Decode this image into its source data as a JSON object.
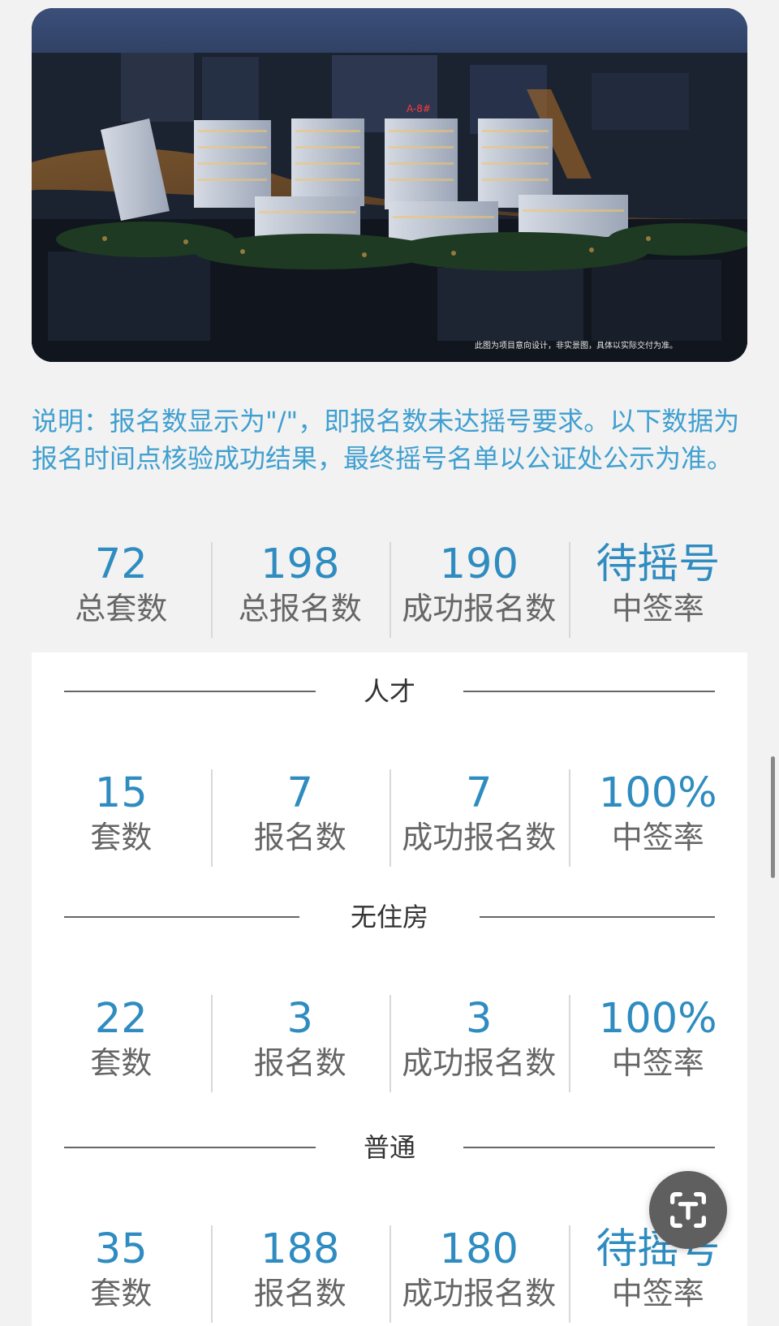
{
  "hero": {
    "caption": "此图为项目意向设计，非实景图，具体以实际交付为准。"
  },
  "notice": {
    "text": "说明：报名数显示为\"/\"，即报名数未达摇号要求。以下数据为报名时间点核验成功结果，最终摇号名单以公证处公示为准。"
  },
  "summary": {
    "items": [
      {
        "value": "72",
        "label": "总套数"
      },
      {
        "value": "198",
        "label": "总报名数"
      },
      {
        "value": "190",
        "label": "成功报名数"
      },
      {
        "value": "待摇号",
        "label": "中签率"
      }
    ]
  },
  "sections": [
    {
      "title": "人才",
      "items": [
        {
          "value": "15",
          "label": "套数"
        },
        {
          "value": "7",
          "label": "报名数"
        },
        {
          "value": "7",
          "label": "成功报名数"
        },
        {
          "value": "100%",
          "label": "中签率"
        }
      ]
    },
    {
      "title": "无住房",
      "items": [
        {
          "value": "22",
          "label": "套数"
        },
        {
          "value": "3",
          "label": "报名数"
        },
        {
          "value": "3",
          "label": "成功报名数"
        },
        {
          "value": "100%",
          "label": "中签率"
        }
      ]
    },
    {
      "title": "普通",
      "items": [
        {
          "value": "35",
          "label": "套数"
        },
        {
          "value": "188",
          "label": "报名数"
        },
        {
          "value": "180",
          "label": "成功报名数"
        },
        {
          "value": "待摇号",
          "label": "中签率"
        }
      ]
    }
  ],
  "icons": {
    "scan": "scan-text-icon"
  }
}
